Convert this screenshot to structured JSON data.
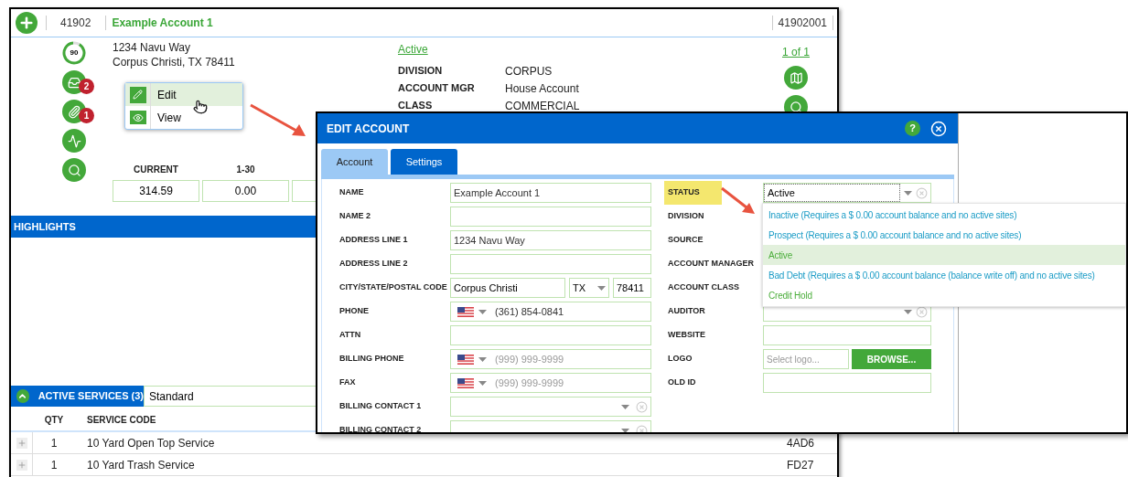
{
  "account_window": {
    "account_number": "41902",
    "account_name": "Example Account 1",
    "site_number": "41902001",
    "score": "90",
    "address_lines": [
      "1234 Navu Way",
      "Corpus Christi, TX 78411"
    ],
    "side_icons": [
      {
        "kind": "documents",
        "badge": "2"
      },
      {
        "kind": "attachments",
        "badge": "1"
      },
      {
        "kind": "chart"
      },
      {
        "kind": "lookup"
      }
    ],
    "status_link": "Active",
    "details": [
      {
        "label": "DIVISION",
        "value": "CORPUS"
      },
      {
        "label": "ACCOUNT MGR",
        "value": "House Account"
      },
      {
        "label": "CLASS",
        "value": "COMMERCIAL"
      }
    ],
    "pager": "1 of 1",
    "context_menu": [
      {
        "kind": "edit",
        "label": "Edit",
        "selected": true
      },
      {
        "kind": "view",
        "label": "View",
        "selected": false
      }
    ],
    "aging": [
      {
        "label": "CURRENT",
        "value": "314.59"
      },
      {
        "label": "1-30",
        "value": "0.00"
      }
    ],
    "highlights_title": "HIGHLIGHTS",
    "services": {
      "title": "ACTIVE SERVICES (3)",
      "expanded": true,
      "filter": "Standard",
      "columns": [
        "QTY",
        "SERVICE CODE"
      ],
      "rows": [
        {
          "qty": "1",
          "service": "10 Yard Open Top Service",
          "code": "4AD6"
        },
        {
          "qty": "1",
          "service": "10 Yard Trash Service",
          "code": "FD27"
        }
      ]
    }
  },
  "edit_dialog": {
    "title": "EDIT ACCOUNT",
    "help": "?",
    "tabs": [
      {
        "label": "Account",
        "selected": true
      },
      {
        "label": "Settings",
        "selected": false
      }
    ],
    "left_fields": [
      {
        "label": "NAME",
        "kind": "text",
        "value": "Example Account 1"
      },
      {
        "label": "NAME 2",
        "kind": "text"
      },
      {
        "label": "ADDRESS LINE 1",
        "kind": "text",
        "value": "1234 Navu Way"
      },
      {
        "label": "ADDRESS LINE 2",
        "kind": "text"
      },
      {
        "label": "CITY/STATE/POSTAL CODE",
        "kind": "city",
        "city": "Corpus Christi",
        "state": "TX",
        "postal": "78411"
      },
      {
        "label": "PHONE",
        "kind": "phone",
        "value": "(361) 854-0841"
      },
      {
        "label": "ATTN",
        "kind": "text"
      },
      {
        "label": "BILLING PHONE",
        "kind": "phone",
        "placeholder": "(999) 999-9999"
      },
      {
        "label": "FAX",
        "kind": "phone",
        "placeholder": "(999) 999-9999"
      },
      {
        "label": "BILLING CONTACT 1",
        "kind": "select"
      },
      {
        "label": "BILLING CONTACT 2",
        "kind": "select"
      }
    ],
    "right_fields": [
      {
        "label": "STATUS",
        "kind": "select",
        "value": "Active",
        "highlighted": true
      },
      {
        "label": "DIVISION",
        "kind": "label",
        "highlighted": false
      },
      {
        "label": "SOURCE",
        "kind": "label",
        "highlighted": false
      },
      {
        "label": "ACCOUNT MANAGER",
        "kind": "label",
        "highlighted": false
      },
      {
        "label": "ACCOUNT CLASS",
        "kind": "label",
        "highlighted": false
      },
      {
        "label": "AUDITOR",
        "kind": "select",
        "highlighted": false
      },
      {
        "label": "WEBSITE",
        "kind": "text",
        "highlighted": false
      },
      {
        "label": "LOGO",
        "kind": "file",
        "placeholder": "Select logo...",
        "button": "BROWSE...",
        "highlighted": false
      },
      {
        "label": "OLD ID",
        "kind": "text",
        "highlighted": false
      }
    ],
    "status_options": [
      {
        "label": "Inactive (Requires a $ 0.00 account balance and no active sites)",
        "selected": false,
        "color": "#1b9cc6"
      },
      {
        "label": "Prospect (Requires a $ 0.00 account balance and no active sites)",
        "selected": false,
        "color": "#1b9cc6"
      },
      {
        "label": "Active",
        "selected": true,
        "color": "#4cae3c"
      },
      {
        "label": "Bad Debt (Requires a $ 0.00 account balance (balance write off) and no active sites)",
        "selected": false,
        "color": "#1b9cc6"
      },
      {
        "label": "Credit Hold",
        "selected": false,
        "color": "#4cae3c"
      }
    ]
  }
}
